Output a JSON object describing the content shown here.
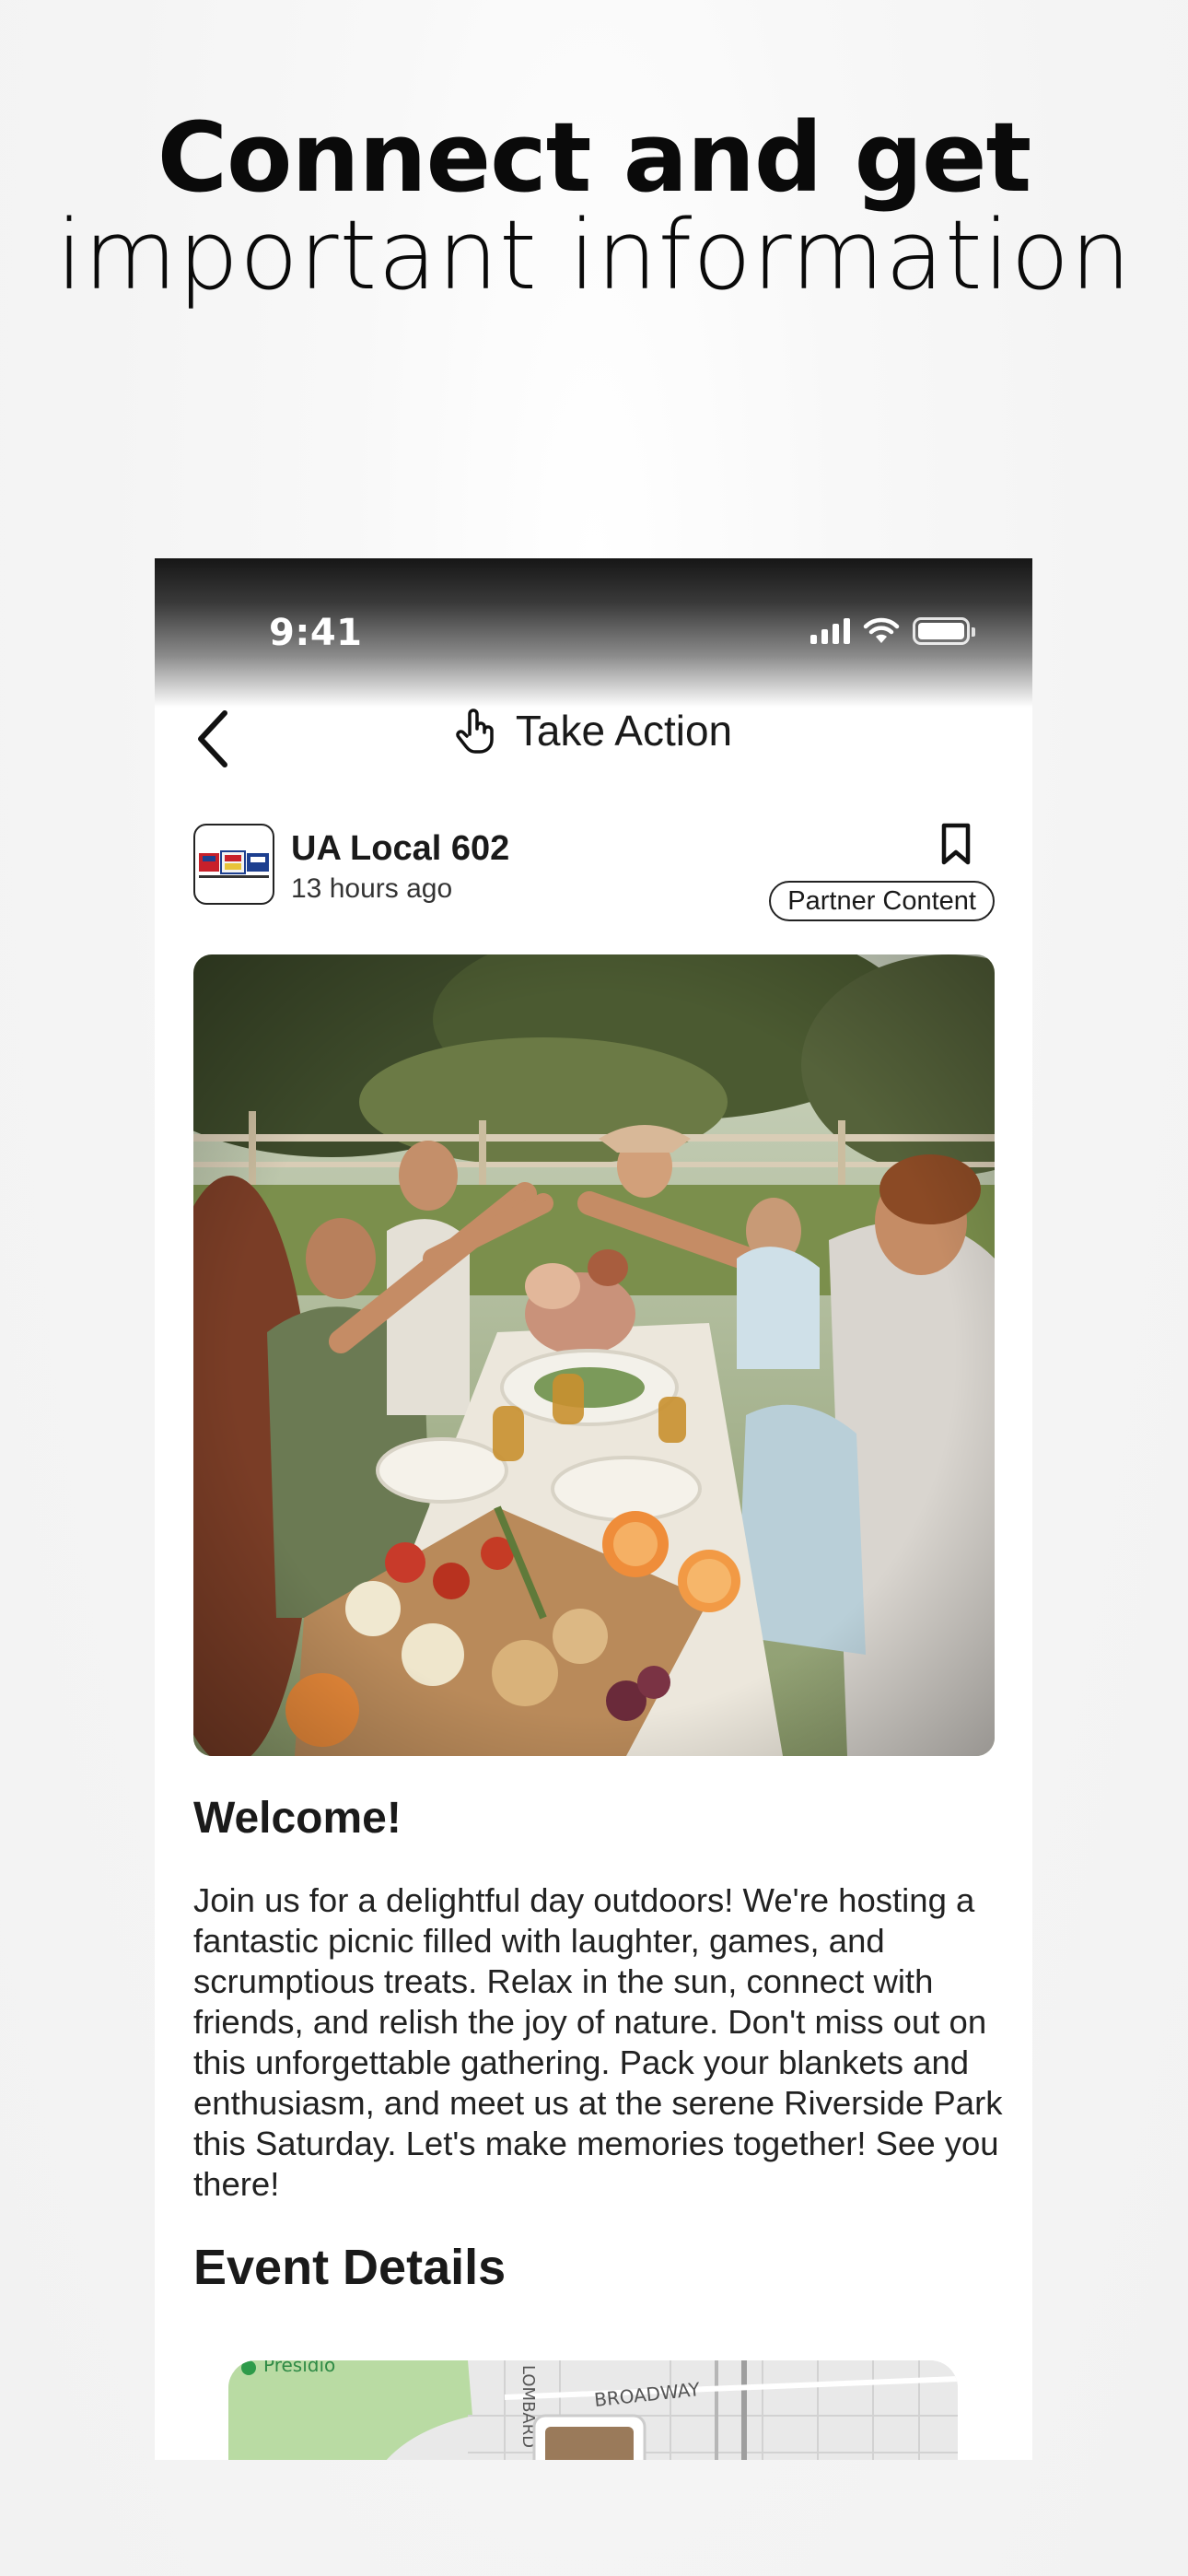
{
  "headline": {
    "line1": "Connect and get",
    "line2": "important information"
  },
  "status_bar": {
    "time": "9:41",
    "icons": [
      "cellular-signal-icon",
      "wifi-icon",
      "battery-icon"
    ]
  },
  "nav": {
    "title": "Take Action",
    "title_icon": "hand-pointer-icon",
    "back_icon": "chevron-left-icon"
  },
  "post": {
    "org_name": "UA Local 602",
    "time_ago": "13 hours ago",
    "badge": "Partner Content",
    "bookmark_icon": "bookmark-icon"
  },
  "content": {
    "title": "Welcome!",
    "body": "Join us for a delightful day outdoors! We're hosting a fantastic picnic filled with laughter, games, and scrumptious treats. Relax in the sun, connect with friends, and relish the joy of nature. Don't miss out on this unforgettable gathering. Pack your blankets and enthusiasm, and meet us at the serene Riverside Park this Saturday. Let's make memories together! See you there!"
  },
  "event_details": {
    "title": "Event Details",
    "map_labels": {
      "park": "Presidio",
      "street1": "BROADWAY",
      "street2": "LOMBARD"
    }
  },
  "colors": {
    "text": "#1a1a1a",
    "map_green": "#b9dba3",
    "map_bg": "#e9e9e9"
  }
}
